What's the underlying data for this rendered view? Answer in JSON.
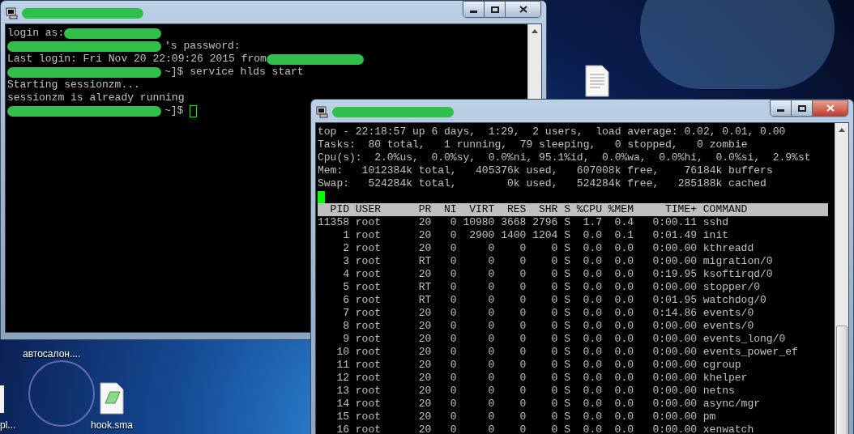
{
  "desktop_icons": [
    {
      "label": "автосалон....",
      "kind": "covered"
    },
    {
      "label": "pl...",
      "kind": "edge"
    },
    {
      "label": "hook.sma",
      "kind": "script"
    },
    {
      "kind": "document"
    }
  ],
  "windows": [
    {
      "active": false,
      "lines": [
        {
          "text": "login as:",
          "kind": "masked_after",
          "cursor": false
        },
        {
          "text": "'s password:",
          "kind": "masked_before",
          "cursor": false
        },
        {
          "text": "Last login: Fri Nov 20 22:09:26 2015 from",
          "kind": "masked_after",
          "cursor": false
        },
        {
          "text": "~]$ service hlds start",
          "kind": "masked_before",
          "cursor": false
        },
        {
          "text": "Starting sessionzm...",
          "kind": "plain",
          "cursor": false
        },
        {
          "text": "sessionzm is already running",
          "kind": "plain",
          "cursor": false
        },
        {
          "text": "~]$",
          "kind": "masked_before",
          "cursor": true
        }
      ]
    },
    {
      "active": true,
      "lines": [
        {
          "text": "top - 22:18:57 up 6 days,  1:29,  2 users,  load average: 0.02, 0.01, 0.00",
          "kind": "plain",
          "cursor": false
        },
        {
          "text": "Tasks:  80 total,   1 running,  79 sleeping,   0 stopped,   0 zombie",
          "kind": "plain",
          "cursor": false
        },
        {
          "text": "Cpu(s):  2.0%us,  0.0%sy,  0.0%ni, 95.1%id,  0.0%wa,  0.0%hi,  0.0%si,  2.9%st",
          "kind": "plain",
          "cursor": false
        },
        {
          "text": "Mem:   1012384k total,   405376k used,   607008k free,    76184k buffers",
          "kind": "plain",
          "cursor": false
        },
        {
          "text": "Swap:   524284k total,        0k used,   524284k free,   285188k cached",
          "kind": "plain",
          "cursor": false
        },
        {
          "kind": "plain",
          "cursor": true
        }
      ],
      "table": {
        "columns": [
          "PID",
          "USER",
          "PR",
          "NI",
          "VIRT",
          "RES",
          "SHR",
          "S",
          "%CPU",
          "%MEM",
          "TIME+",
          "COMMAND"
        ],
        "rows": [
          [
            "11358",
            "root",
            "20",
            "0",
            "10980",
            "3668",
            "2796",
            "S",
            "1.7",
            "0.4",
            "0:00.11",
            "sshd"
          ],
          [
            "1",
            "root",
            "20",
            "0",
            "2900",
            "1400",
            "1204",
            "S",
            "0.0",
            "0.1",
            "0:01.49",
            "init"
          ],
          [
            "2",
            "root",
            "20",
            "0",
            "0",
            "0",
            "0",
            "S",
            "0.0",
            "0.0",
            "0:00.00",
            "kthreadd"
          ],
          [
            "3",
            "root",
            "RT",
            "0",
            "0",
            "0",
            "0",
            "S",
            "0.0",
            "0.0",
            "0:00.00",
            "migration/0"
          ],
          [
            "4",
            "root",
            "20",
            "0",
            "0",
            "0",
            "0",
            "S",
            "0.0",
            "0.0",
            "0:19.95",
            "ksoftirqd/0"
          ],
          [
            "5",
            "root",
            "RT",
            "0",
            "0",
            "0",
            "0",
            "S",
            "0.0",
            "0.0",
            "0:00.00",
            "stopper/0"
          ],
          [
            "6",
            "root",
            "RT",
            "0",
            "0",
            "0",
            "0",
            "S",
            "0.0",
            "0.0",
            "0:01.95",
            "watchdog/0"
          ],
          [
            "7",
            "root",
            "20",
            "0",
            "0",
            "0",
            "0",
            "S",
            "0.0",
            "0.0",
            "0:14.86",
            "events/0"
          ],
          [
            "8",
            "root",
            "20",
            "0",
            "0",
            "0",
            "0",
            "S",
            "0.0",
            "0.0",
            "0:00.00",
            "events/0"
          ],
          [
            "9",
            "root",
            "20",
            "0",
            "0",
            "0",
            "0",
            "S",
            "0.0",
            "0.0",
            "0:00.00",
            "events_long/0"
          ],
          [
            "10",
            "root",
            "20",
            "0",
            "0",
            "0",
            "0",
            "S",
            "0.0",
            "0.0",
            "0:00.00",
            "events_power_ef"
          ],
          [
            "11",
            "root",
            "20",
            "0",
            "0",
            "0",
            "0",
            "S",
            "0.0",
            "0.0",
            "0:00.00",
            "cgroup"
          ],
          [
            "12",
            "root",
            "20",
            "0",
            "0",
            "0",
            "0",
            "S",
            "0.0",
            "0.0",
            "0:00.00",
            "khelper"
          ],
          [
            "13",
            "root",
            "20",
            "0",
            "0",
            "0",
            "0",
            "S",
            "0.0",
            "0.0",
            "0:00.00",
            "netns"
          ],
          [
            "14",
            "root",
            "20",
            "0",
            "0",
            "0",
            "0",
            "S",
            "0.0",
            "0.0",
            "0:00.00",
            "async/mgr"
          ],
          [
            "15",
            "root",
            "20",
            "0",
            "0",
            "0",
            "0",
            "S",
            "0.0",
            "0.0",
            "0:00.00",
            "pm"
          ],
          [
            "16",
            "root",
            "20",
            "0",
            "0",
            "0",
            "0",
            "S",
            "0.0",
            "0.0",
            "0:00.00",
            "xenwatch"
          ]
        ]
      }
    }
  ]
}
